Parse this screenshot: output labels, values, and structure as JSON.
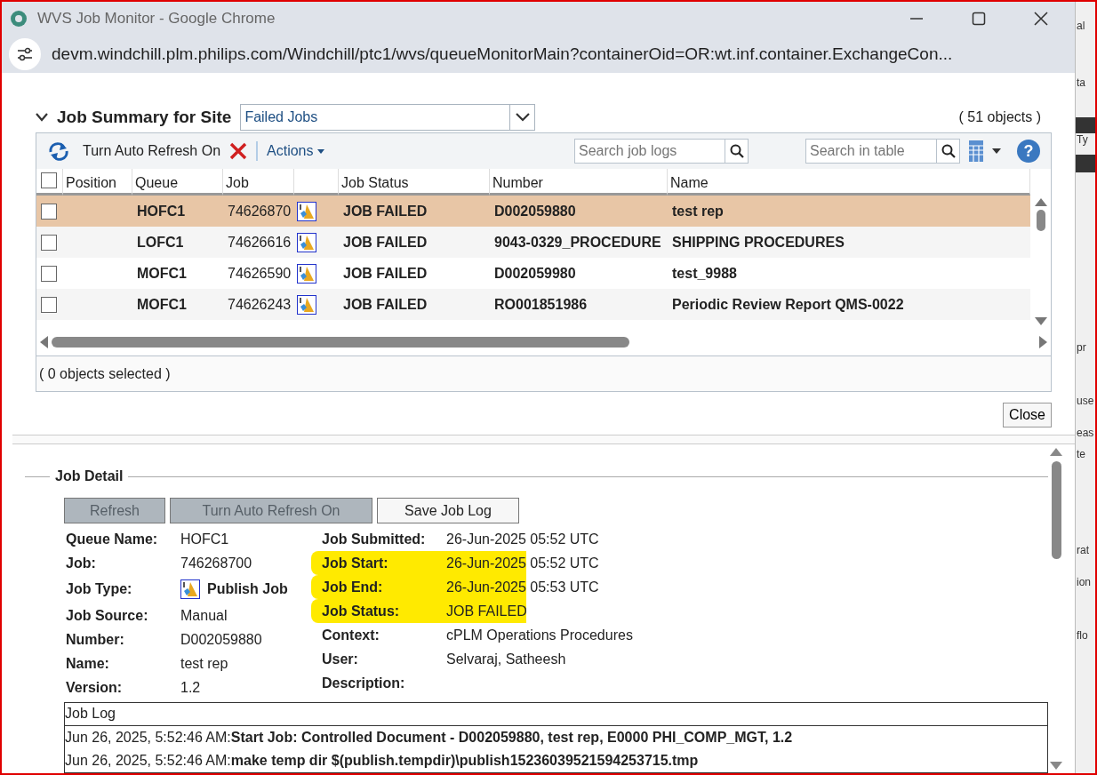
{
  "window": {
    "title": "WVS Job Monitor - Google Chrome",
    "url": "devm.windchill.plm.philips.com/Windchill/ptc1/wvs/queueMonitorMain?containerOid=OR:wt.inf.container.ExchangeCon..."
  },
  "summary": {
    "title": "Job Summary for Site",
    "expanded": true,
    "filter": "Failed Jobs",
    "all_checked": false,
    "count": "( 51 objects )",
    "toolbar": {
      "refresh_label": "Turn Auto Refresh On",
      "actions": "Actions",
      "log_search_placeholder": "Search job logs",
      "table_search_placeholder": "Search in table",
      "help": "?"
    },
    "columns": [
      {
        "kind": "check"
      },
      {
        "kind": "text",
        "label": "Position"
      },
      {
        "kind": "text",
        "label": "Queue"
      },
      {
        "kind": "text",
        "label": "Job"
      },
      {
        "kind": "icon"
      },
      {
        "kind": "text",
        "label": "Job Status"
      },
      {
        "kind": "text",
        "label": "Number"
      },
      {
        "kind": "text",
        "label": "Name"
      }
    ],
    "rows": [
      {
        "selected": true,
        "checked": false,
        "queue": "HOFC1",
        "job": "74626870",
        "status": "JOB FAILED",
        "number": "D002059880",
        "name": "test rep"
      },
      {
        "selected": false,
        "checked": false,
        "queue": "LOFC1",
        "job": "74626616",
        "status": "JOB FAILED",
        "number": "9043-0329_PROCEDURE",
        "name": "SHIPPING PROCEDURES"
      },
      {
        "selected": false,
        "checked": false,
        "queue": "MOFC1",
        "job": "74626590",
        "status": "JOB FAILED",
        "number": "D002059980",
        "name": "test_9988"
      },
      {
        "selected": false,
        "checked": false,
        "queue": "MOFC1",
        "job": "74626243",
        "status": "JOB FAILED",
        "number": "RO001851986",
        "name": "Periodic Review Report QMS-0022"
      }
    ],
    "footer": "( 0 objects selected )",
    "close": "Close"
  },
  "detail": {
    "title": "Job Detail",
    "buttons": [
      {
        "label": "Refresh",
        "disabled": true
      },
      {
        "label": "Turn Auto Refresh On",
        "disabled": true
      },
      {
        "label": "Save Job Log",
        "disabled": false
      }
    ],
    "left_fields": [
      {
        "label": "Queue Name:",
        "value": "HOFC1",
        "kind": "text"
      },
      {
        "label": "Job:",
        "value": "746268700",
        "kind": "text"
      },
      {
        "label": "Job Type:",
        "value": "Publish Job",
        "kind": "icon"
      },
      {
        "label": "Job Source:",
        "value": "Manual",
        "kind": "text"
      },
      {
        "label": "Number:",
        "value": "D002059880",
        "kind": "text"
      },
      {
        "label": "Name:",
        "value": "test rep",
        "kind": "text"
      },
      {
        "label": "Version:",
        "value": "1.2",
        "kind": "text"
      }
    ],
    "right_fields": [
      {
        "label": "Job Submitted:",
        "value": "26-Jun-2025 05:52 UTC",
        "highlighted": false
      },
      {
        "label": "Job Start:",
        "value": "26-Jun-2025 05:52 UTC",
        "highlighted": true
      },
      {
        "label": "Job End:",
        "value": "26-Jun-2025 05:53 UTC",
        "highlighted": true
      },
      {
        "label": "Job Status:",
        "value": "JOB FAILED",
        "highlighted": true
      },
      {
        "label": "Context:",
        "value": "cPLM Operations Procedures",
        "highlighted": false
      },
      {
        "label": "User:",
        "value": "Selvaraj, Satheesh",
        "highlighted": false
      },
      {
        "label": "Description:",
        "highlighted": false
      }
    ],
    "log": {
      "title": "Job Log",
      "lines": [
        {
          "time": "Jun 26, 2025, 5:52:46 AM:",
          "message": "Start Job: Controlled Document - D002059880, test rep, E0000 PHI_COMP_MGT, 1.2"
        },
        {
          "time": "Jun 26, 2025, 5:52:46 AM:",
          "message": "make temp dir $(publish.tempdir)\\publish15236039521594253715.tmp"
        }
      ]
    }
  },
  "background": {
    "fragments": [
      "al",
      "ta",
      "Ty",
      "pr",
      "use",
      "eas",
      "te",
      "rat",
      "ion",
      "flo"
    ]
  }
}
